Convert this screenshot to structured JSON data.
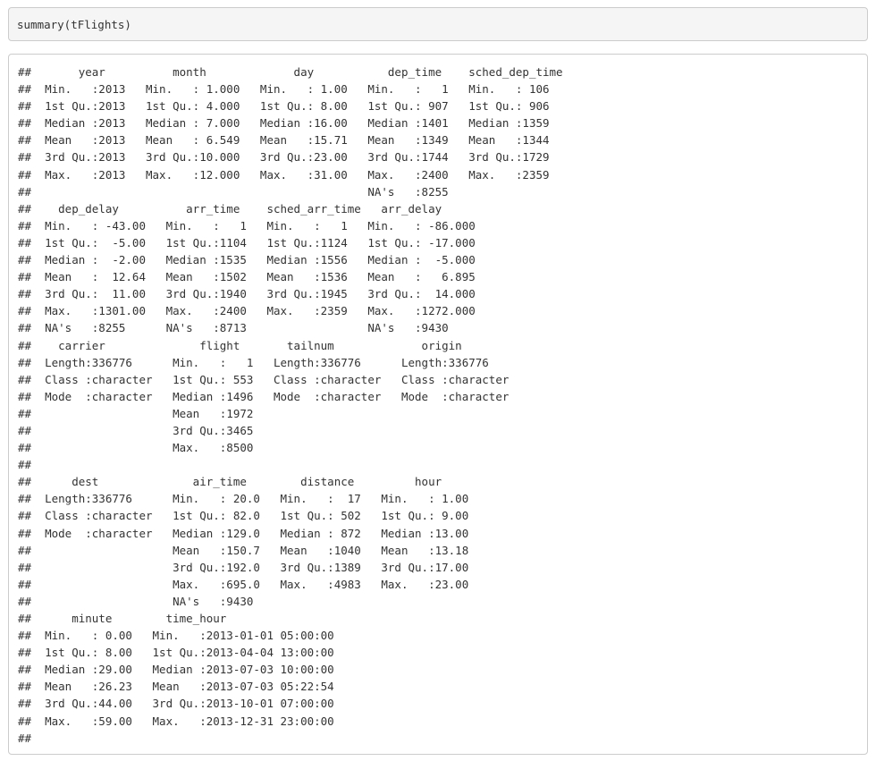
{
  "input": {
    "code": "summary(tFlights)"
  },
  "output": {
    "lines": [
      "##       year          month             day           dep_time    sched_dep_time",
      "##  Min.   :2013   Min.   : 1.000   Min.   : 1.00   Min.   :   1   Min.   : 106  ",
      "##  1st Qu.:2013   1st Qu.: 4.000   1st Qu.: 8.00   1st Qu.: 907   1st Qu.: 906  ",
      "##  Median :2013   Median : 7.000   Median :16.00   Median :1401   Median :1359  ",
      "##  Mean   :2013   Mean   : 6.549   Mean   :15.71   Mean   :1349   Mean   :1344  ",
      "##  3rd Qu.:2013   3rd Qu.:10.000   3rd Qu.:23.00   3rd Qu.:1744   3rd Qu.:1729  ",
      "##  Max.   :2013   Max.   :12.000   Max.   :31.00   Max.   :2400   Max.   :2359  ",
      "##                                                  NA's   :8255                 ",
      "##    dep_delay          arr_time    sched_arr_time   arr_delay       ",
      "##  Min.   : -43.00   Min.   :   1   Min.   :   1   Min.   : -86.000  ",
      "##  1st Qu.:  -5.00   1st Qu.:1104   1st Qu.:1124   1st Qu.: -17.000  ",
      "##  Median :  -2.00   Median :1535   Median :1556   Median :  -5.000  ",
      "##  Mean   :  12.64   Mean   :1502   Mean   :1536   Mean   :   6.895  ",
      "##  3rd Qu.:  11.00   3rd Qu.:1940   3rd Qu.:1945   3rd Qu.:  14.000  ",
      "##  Max.   :1301.00   Max.   :2400   Max.   :2359   Max.   :1272.000  ",
      "##  NA's   :8255      NA's   :8713                  NA's   :9430      ",
      "##    carrier              flight       tailnum             origin         ",
      "##  Length:336776      Min.   :   1   Length:336776      Length:336776     ",
      "##  Class :character   1st Qu.: 553   Class :character   Class :character  ",
      "##  Mode  :character   Median :1496   Mode  :character   Mode  :character  ",
      "##                     Mean   :1972                                        ",
      "##                     3rd Qu.:3465                                        ",
      "##                     Max.   :8500                                        ",
      "##                                                                         ",
      "##      dest              air_time        distance         hour       ",
      "##  Length:336776      Min.   : 20.0   Min.   :  17   Min.   : 1.00  ",
      "##  Class :character   1st Qu.: 82.0   1st Qu.: 502   1st Qu.: 9.00  ",
      "##  Mode  :character   Median :129.0   Median : 872   Median :13.00  ",
      "##                     Mean   :150.7   Mean   :1040   Mean   :13.18  ",
      "##                     3rd Qu.:192.0   3rd Qu.:1389   3rd Qu.:17.00  ",
      "##                     Max.   :695.0   Max.   :4983   Max.   :23.00  ",
      "##                     NA's   :9430                                  ",
      "##      minute        time_hour                  ",
      "##  Min.   : 0.00   Min.   :2013-01-01 05:00:00  ",
      "##  1st Qu.: 8.00   1st Qu.:2013-04-04 13:00:00  ",
      "##  Median :29.00   Median :2013-07-03 10:00:00  ",
      "##  Mean   :26.23   Mean   :2013-07-03 05:22:54  ",
      "##  3rd Qu.:44.00   3rd Qu.:2013-10-01 07:00:00  ",
      "##  Max.   :59.00   Max.   :2013-12-31 23:00:00  ",
      "##"
    ]
  }
}
